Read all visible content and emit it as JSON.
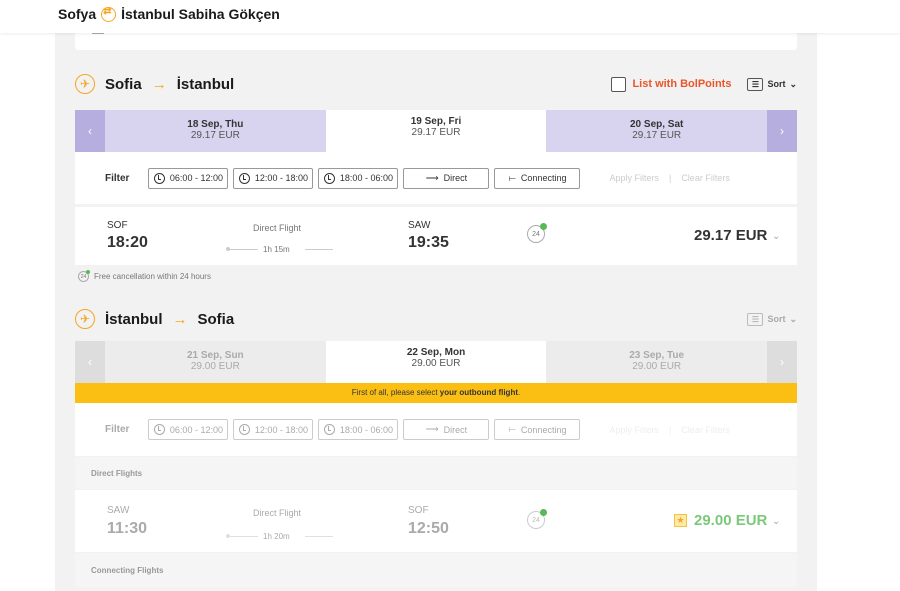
{
  "header": {
    "origin": "Sofya",
    "destination": "İstanbul Sabiha Gökçen"
  },
  "outbound": {
    "from": "Sofia",
    "to": "İstanbul",
    "bolpoints_label": "List with BolPoints",
    "sort_label": "Sort",
    "dates": [
      {
        "day": "18 Sep, Thu",
        "price": "29.17 EUR"
      },
      {
        "day": "19 Sep, Fri",
        "price": "29.17 EUR"
      },
      {
        "day": "20 Sep, Sat",
        "price": "29.17 EUR"
      }
    ],
    "filter": {
      "label": "Filter",
      "times": [
        "06:00 - 12:00",
        "12:00 - 18:00",
        "18:00 - 06:00"
      ],
      "direct": "Direct",
      "connecting": "Connecting",
      "apply": "Apply Filters",
      "clear": "Clear Filters"
    },
    "flight": {
      "dep_code": "SOF",
      "dep_time": "18:20",
      "type": "Direct Flight",
      "duration": "1h 15m",
      "arr_code": "SAW",
      "arr_time": "19:35",
      "price": "29.17 EUR"
    },
    "free_cancel": "Free cancellation within 24 hours"
  },
  "return": {
    "from": "İstanbul",
    "to": "Sofia",
    "sort_label": "Sort",
    "dates": [
      {
        "day": "21 Sep, Sun",
        "price": "29.00 EUR"
      },
      {
        "day": "22 Sep, Mon",
        "price": "29.00 EUR"
      },
      {
        "day": "23 Sep, Tue",
        "price": "29.00 EUR"
      }
    ],
    "warning_prefix": "First of all, please select ",
    "warning_bold": "your outbound flight",
    "warning_suffix": ".",
    "filter": {
      "label": "Filter",
      "times": [
        "06:00 - 12:00",
        "12:00 - 18:00",
        "18:00 - 06:00"
      ],
      "direct": "Direct",
      "connecting": "Connecting",
      "apply": "Apply Filters",
      "clear": "Clear Filters"
    },
    "direct_flights_label": "Direct Flights",
    "flight": {
      "dep_code": "SAW",
      "dep_time": "11:30",
      "type": "Direct Flight",
      "duration": "1h 20m",
      "arr_code": "SOF",
      "arr_time": "12:50",
      "price": "29.00 EUR"
    },
    "connecting_flights_label": "Connecting Flights"
  },
  "icons": {
    "plane": "plane-icon",
    "arrow": "arrow-right-icon",
    "clock": "clock-icon",
    "cancel24": "free-cancel-24h-icon",
    "star": "star-icon"
  },
  "colors": {
    "accent_orange": "#f5a623",
    "bolpoints_red": "#e8562a",
    "date_bar": "#d8d3ef",
    "warning": "#fbbf14",
    "price_green": "#7cc87a"
  }
}
